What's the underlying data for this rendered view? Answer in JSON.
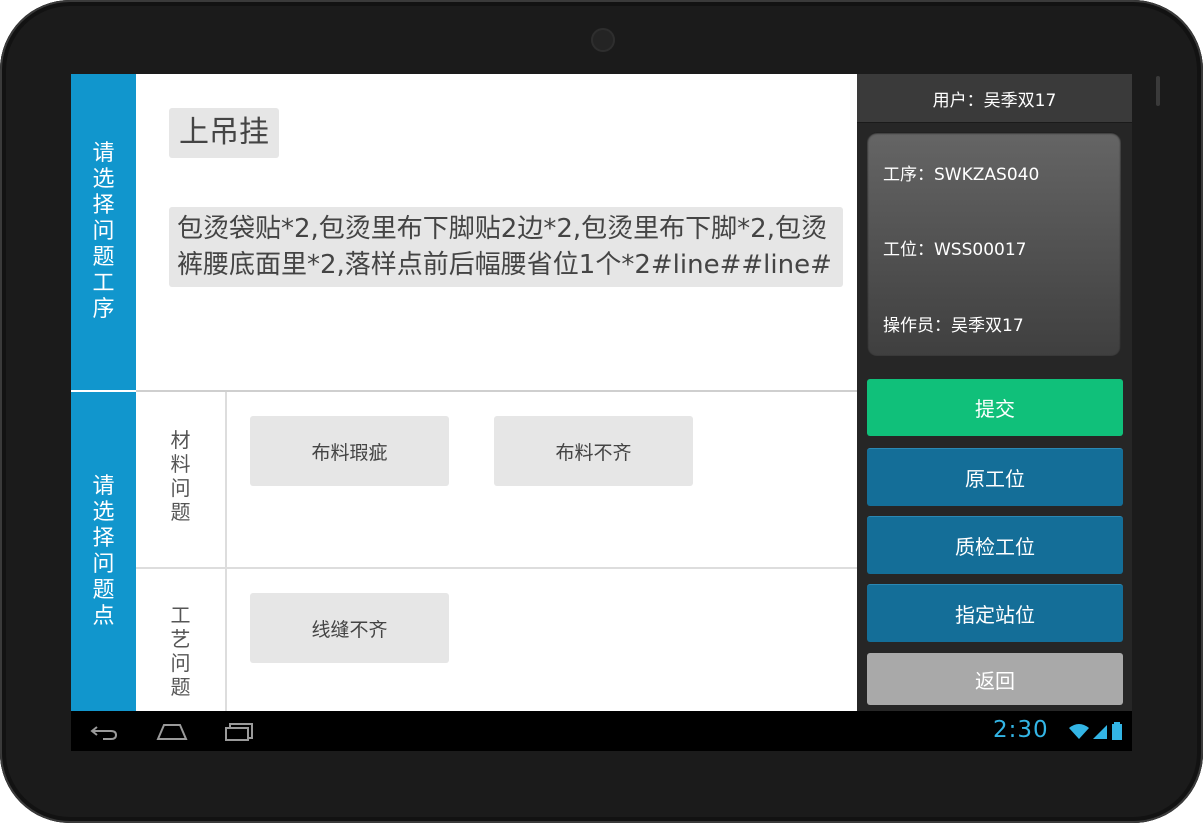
{
  "sidebar": {
    "select_step_label": "请选择问题工序",
    "select_point_label": "请选择问题点"
  },
  "step": {
    "title": "上吊挂",
    "description": "包烫袋贴*2,包烫里布下脚贴2边*2,包烫里布下脚*2,包烫裤腰底面里*2,落样点前后幅腰省位1个*2#line##line#"
  },
  "issue_categories": [
    {
      "name": "材料问题",
      "issues": [
        "布料瑕疵",
        "布料不齐"
      ]
    },
    {
      "name": "工艺问题",
      "issues": [
        "线缝不齐"
      ]
    }
  ],
  "user_panel": {
    "user": "用户：吴季双17",
    "process": "工序：SWKZAS040",
    "station": "工位：WSS00017",
    "operator": "操作员：吴季双17"
  },
  "actions": {
    "submit": "提交",
    "original_station": "原工位",
    "qc_station": "质检工位",
    "assign_station": "指定站位",
    "back": "返回"
  },
  "colors": {
    "sidebar_blue": "#1196cd",
    "submit_green": "#10c07a",
    "station_blue": "#146e98",
    "back_gray": "#a9a9a9"
  },
  "status_bar": {
    "time": "2:30"
  }
}
